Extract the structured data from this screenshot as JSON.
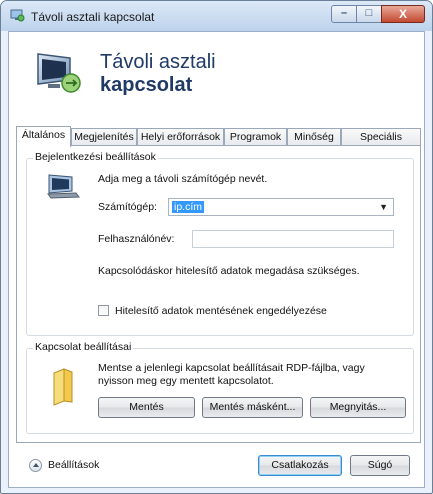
{
  "window": {
    "title": "Távoli asztali kapcsolat",
    "controls": {
      "minimize": "–",
      "maximize": "□",
      "close": "X"
    }
  },
  "header": {
    "title_line1": "Távoli asztali",
    "title_line2": "kapcsolat"
  },
  "tabs": [
    {
      "label": "Általános",
      "active": true
    },
    {
      "label": "Megjelenítés",
      "active": false
    },
    {
      "label": "Helyi erőforrások",
      "active": false
    },
    {
      "label": "Programok",
      "active": false
    },
    {
      "label": "Minőség",
      "active": false
    },
    {
      "label": "Speciális",
      "active": false
    }
  ],
  "login_group": {
    "title": "Bejelentkezési beállítások",
    "prompt": "Adja meg a távoli számítógép nevét.",
    "computer_label": "Számítógép:",
    "computer_value": "ip.cím",
    "username_label": "Felhasználónév:",
    "username_value": "",
    "credentials_note": "Kapcsolódáskor hitelesítő adatok megadása szükséges.",
    "save_credentials_label": "Hitelesítő adatok mentésének engedélyezése",
    "save_credentials_checked": false
  },
  "settings_group": {
    "title": "Kapcsolat beállításai",
    "desc_line1": "Mentse a jelenlegi kapcsolat beállításait RDP-fájlba, vagy",
    "desc_line2": "nyisson meg egy mentett kapcsolatot.",
    "save_button": "Mentés",
    "save_as_button": "Mentés másként...",
    "open_button": "Megnyitás..."
  },
  "footer": {
    "options_label": "Beállítások",
    "connect_button": "Csatlakozás",
    "help_button": "Súgó"
  }
}
